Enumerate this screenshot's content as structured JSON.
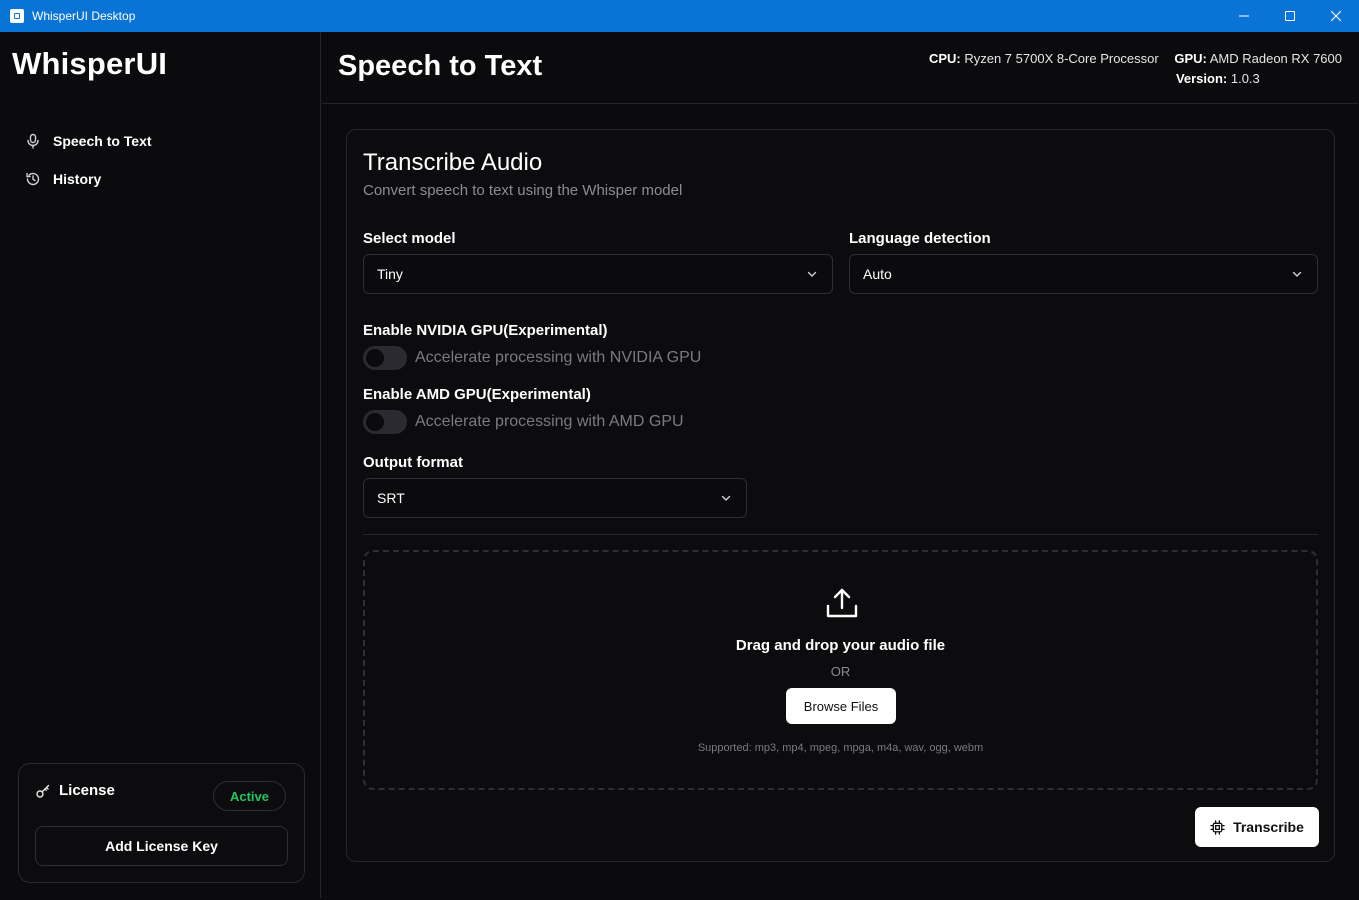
{
  "window": {
    "title": "WhisperUI Desktop",
    "controls": [
      "minimize-icon",
      "maximize-icon",
      "close-icon"
    ]
  },
  "sidebar": {
    "logo": "WhisperUI",
    "items": [
      {
        "label": "Speech to Text",
        "icon": "microphone-icon"
      },
      {
        "label": "History",
        "icon": "history-icon"
      }
    ],
    "license": {
      "label": "License",
      "icon": "key-icon",
      "status": "Active",
      "status_color": "#22c55e",
      "add_key_label": "Add License Key"
    }
  },
  "header": {
    "title": "Speech to Text",
    "cpu_label": "CPU:",
    "cpu_value": "Ryzen 7 5700X 8-Core Processor",
    "gpu_label": "GPU:",
    "gpu_value": "AMD Radeon RX 7600",
    "version_label": "Version:",
    "version_value": "1.0.3"
  },
  "card": {
    "title": "Transcribe Audio",
    "subtitle": "Convert speech to text using the Whisper model",
    "model": {
      "label": "Select model",
      "value": "Tiny"
    },
    "language": {
      "label": "Language detection",
      "value": "Auto"
    },
    "nvidia": {
      "label": "Enable NVIDIA GPU(Experimental)",
      "description": "Accelerate processing with NVIDIA GPU",
      "enabled": false
    },
    "amd": {
      "label": "Enable AMD GPU(Experimental)",
      "description": "Accelerate processing with AMD GPU",
      "enabled": false
    },
    "output": {
      "label": "Output format",
      "value": "SRT"
    },
    "dropzone": {
      "icon": "upload-icon",
      "title": "Drag and drop your audio file",
      "or": "OR",
      "browse_label": "Browse Files",
      "supported": "Supported: mp3, mp4, mpeg, mpga, m4a, wav, ogg, webm"
    },
    "transcribe_label": "Transcribe",
    "transcribe_icon": "cpu-icon"
  }
}
